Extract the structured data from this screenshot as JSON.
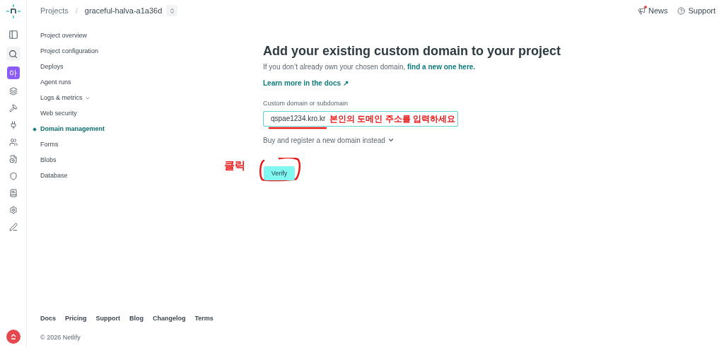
{
  "header": {
    "breadcrumb": {
      "root": "Projects",
      "separator": "/",
      "project": "graceful-halva-a1a36d"
    },
    "links": [
      {
        "label": "News",
        "unread": true
      },
      {
        "label": "Support",
        "unread": false
      }
    ]
  },
  "rail": {
    "avatar": "아"
  },
  "nav": [
    {
      "label": "Project overview",
      "kind": "link",
      "selected": false
    },
    {
      "label": "Project configuration",
      "kind": "link",
      "selected": false
    },
    {
      "label": "Deploys",
      "kind": "link",
      "selected": false
    },
    {
      "label": "Agent runs",
      "kind": "link",
      "selected": false
    },
    {
      "label": "Logs & metrics",
      "kind": "menu",
      "selected": false
    },
    {
      "label": "Web security",
      "kind": "link",
      "selected": false
    },
    {
      "label": "Domain management",
      "kind": "link",
      "selected": true
    },
    {
      "label": "Forms",
      "kind": "link",
      "selected": false
    },
    {
      "label": "Blobs",
      "kind": "link",
      "selected": false
    },
    {
      "label": "Database",
      "kind": "link",
      "selected": false
    }
  ],
  "main": {
    "title": "Add your existing custom domain to your project",
    "intro": "If you don’t already own your chosen domain,",
    "intro_link": "find a new one here.",
    "docs_link": "Learn more in the docs ↗",
    "field": {
      "label": "Custom domain or subdomain",
      "value": "qspae1234.kro.kr"
    },
    "buy_toggle": "Buy and register a new domain instead",
    "verify": "Verify"
  },
  "annotations": {
    "field_note": "본인의 도메인 주소를 입력하세요",
    "click_note": "클릭"
  },
  "footer": {
    "links": [
      "Docs",
      "Pricing",
      "Support",
      "Blog",
      "Changelog",
      "Terms"
    ],
    "copyright": "© 2026 Netlify"
  }
}
